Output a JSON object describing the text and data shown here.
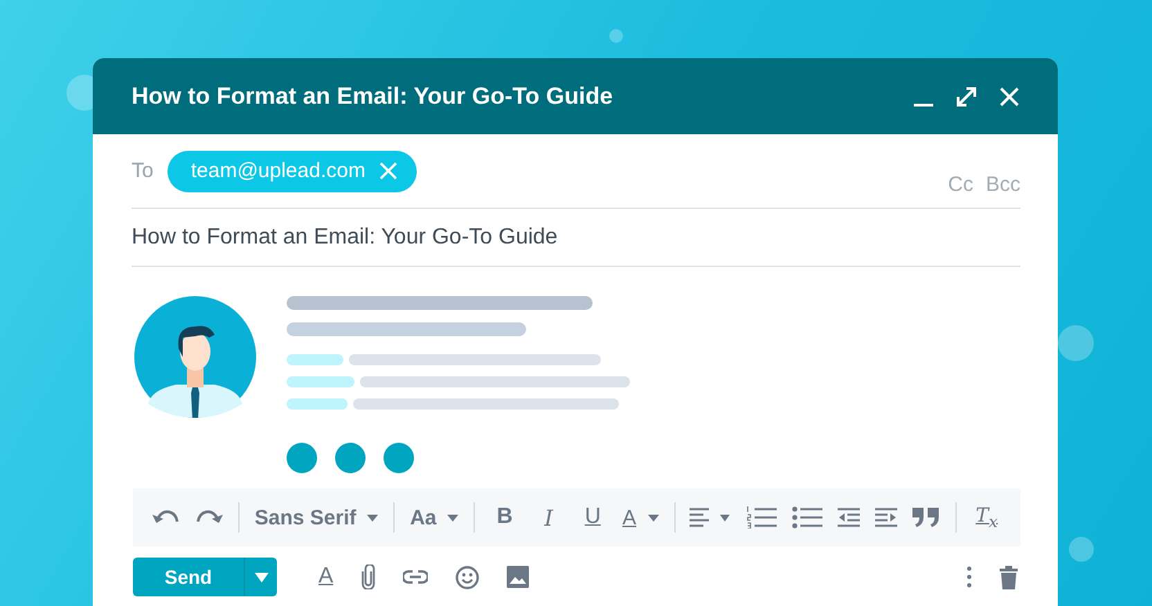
{
  "window": {
    "title": "How to Format an Email: Your Go-To Guide"
  },
  "to": {
    "label": "To",
    "chips": [
      {
        "address": "team@uplead.com"
      }
    ],
    "cc": "Cc",
    "bcc": "Bcc"
  },
  "subject": {
    "value": "How to Format an Email: Your Go-To Guide"
  },
  "toolbar": {
    "font": "Sans Serif",
    "size": "Aa",
    "bold": "B",
    "italic": "I",
    "underline": "U",
    "text_color": "A",
    "clear_format": "T$_{x}$"
  },
  "actions": {
    "send": "Send",
    "formatting": "A"
  }
}
